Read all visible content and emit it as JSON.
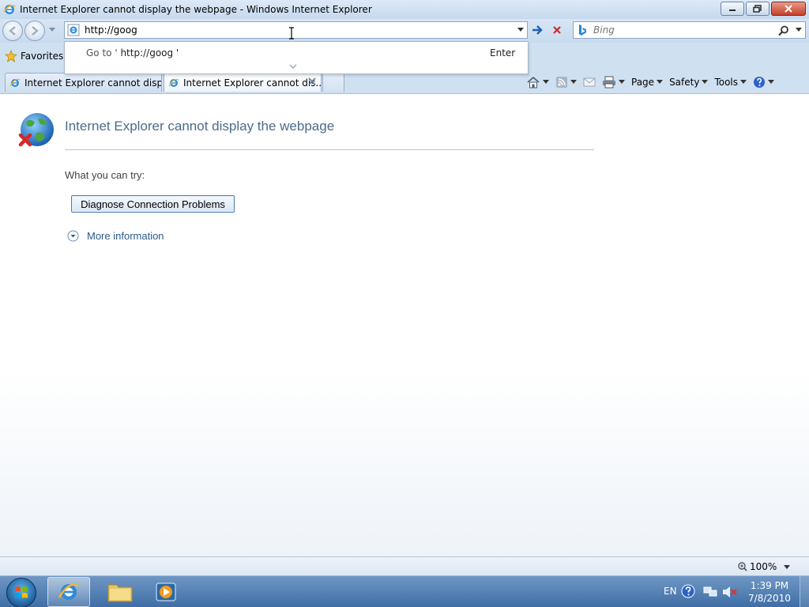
{
  "window": {
    "title": "Internet Explorer cannot display the webpage - Windows Internet Explorer"
  },
  "navbar": {
    "address_value": "http://goog",
    "search_placeholder": "Bing"
  },
  "autocomplete": {
    "goto_prefix": "Go to '",
    "goto_url": " http://goog '",
    "enter_label": "Enter"
  },
  "favorites": {
    "label": "Favorites"
  },
  "tabs": [
    {
      "label": "Internet Explorer cannot displa..."
    },
    {
      "label": "Internet Explorer cannot dis..."
    }
  ],
  "commandbar": {
    "page_label": "Page",
    "safety_label": "Safety",
    "tools_label": "Tools"
  },
  "content": {
    "title": "Internet Explorer cannot display the webpage",
    "try_label": "What you can try:",
    "diagnose_label": "Diagnose Connection Problems",
    "more_info_label": "More information"
  },
  "statusbar": {
    "zoom": "100%"
  },
  "taskbar": {
    "language": "EN",
    "time": "1:39 PM",
    "date": "7/8/2010"
  },
  "colors": {
    "title_text": "#4b6b8a",
    "link_text": "#2a5a8a",
    "taskbar": "#4a78ae"
  }
}
